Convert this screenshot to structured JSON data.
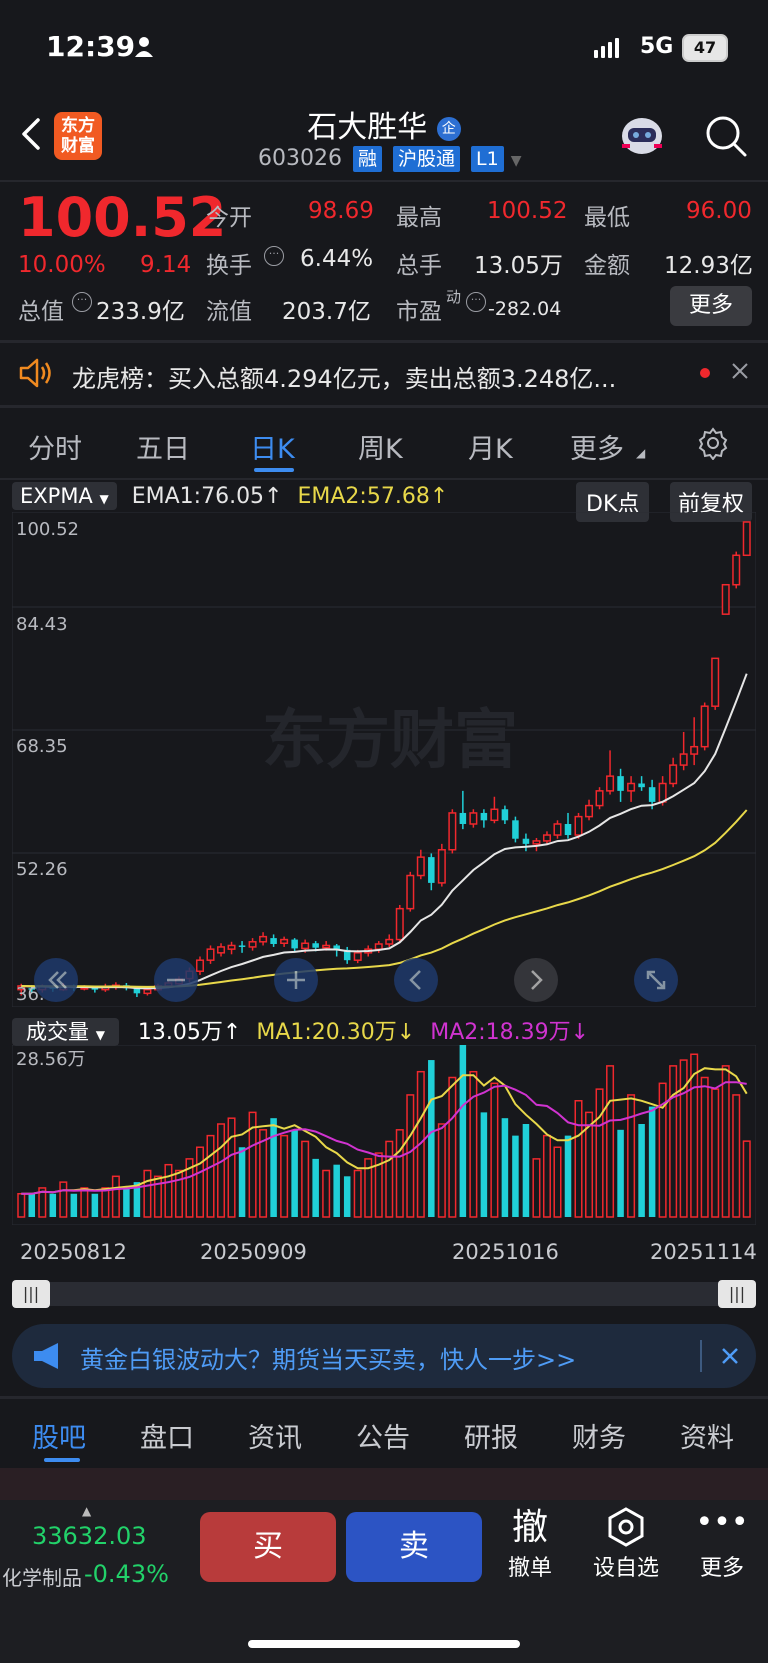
{
  "status_bar": {
    "time": "12:39",
    "network": "5G",
    "battery": "47"
  },
  "header": {
    "title": "石大胜华",
    "code": "603026",
    "tags": [
      "融",
      "沪股通",
      "L1"
    ],
    "logo_text": "东方财富",
    "badge": "企"
  },
  "quote": {
    "price": "100.52",
    "change_pct": "10.00%",
    "change": "9.14",
    "fields": [
      {
        "label": "今开",
        "value": "98.69",
        "color": "red"
      },
      {
        "label": "最高",
        "value": "100.52",
        "color": "red"
      },
      {
        "label": "最低",
        "value": "96.00",
        "color": "red"
      },
      {
        "label": "换手",
        "value": "6.44%",
        "color": "white"
      },
      {
        "label": "总手",
        "value": "13.05万",
        "color": "white"
      },
      {
        "label": "金额",
        "value": "12.93亿",
        "color": "white"
      },
      {
        "label": "总值",
        "value": "233.9亿",
        "color": "white"
      },
      {
        "label": "流值",
        "value": "203.7亿",
        "color": "white"
      },
      {
        "label": "市盈",
        "value": "-282.04",
        "color": "white"
      }
    ],
    "pe_superscript": "动",
    "more_label": "更多"
  },
  "notice": {
    "text": "龙虎榜：买入总额4.294亿元，卖出总额3.248亿..."
  },
  "chart_tabs": [
    "分时",
    "五日",
    "日K",
    "周K",
    "月K",
    "更多"
  ],
  "active_tab": "日K",
  "indicator": {
    "name": "EXPMA",
    "ema1": "EMA1:76.05",
    "ema2": "EMA2:57.68",
    "dk_label": "DK点",
    "adjust_label": "前复权",
    "y_labels": [
      "100.52",
      "84.43",
      "68.35",
      "52.26",
      "36."
    ],
    "watermark": "东方财富"
  },
  "volume": {
    "name": "成交量",
    "value": "13.05万",
    "ma1": "MA1:20.30万",
    "ma2": "MA2:18.39万",
    "max_label": "28.56万",
    "dates": [
      "20250812",
      "20250909",
      "20251016",
      "20251114"
    ]
  },
  "ad_banner": {
    "text": "黄金白银波动大？期货当天买卖，快人一步>>"
  },
  "bottom_tabs": [
    "股吧",
    "盘口",
    "资讯",
    "公告",
    "研报",
    "财务",
    "资料"
  ],
  "footer": {
    "index_value": "33632.03",
    "sector": "化学制品",
    "sector_change": "-0.43%",
    "buy": "买",
    "sell": "卖",
    "cancel_icon_text": "撤",
    "cancel": "撤单",
    "watch": "设自选",
    "more": "更多"
  },
  "colors": {
    "up": "#f0282d",
    "down": "#20d0d8",
    "ema1": "#e6e6e6",
    "ema2": "#e8d84a",
    "ma2": "#d033d0",
    "accent": "#3d8cf0"
  },
  "chart_data": {
    "type": "candlestick",
    "candles": [
      [
        37,
        37.5,
        36.2,
        37.8
      ],
      [
        37.2,
        37,
        36.5,
        37.6
      ],
      [
        37,
        37.4,
        36.6,
        37.7
      ],
      [
        37.3,
        37.1,
        36.7,
        37.6
      ],
      [
        37,
        37.5,
        36.8,
        37.9
      ],
      [
        37.4,
        37.2,
        36.8,
        37.7
      ],
      [
        37.1,
        37.3,
        36.9,
        37.6
      ],
      [
        37.3,
        37,
        36.6,
        37.5
      ],
      [
        37,
        37.4,
        36.7,
        37.8
      ],
      [
        37.4,
        37.6,
        37,
        38
      ],
      [
        37.6,
        37.2,
        36.9,
        37.9
      ],
      [
        37.2,
        36.5,
        36,
        37.4
      ],
      [
        36.5,
        37,
        36.2,
        37.3
      ],
      [
        37,
        37.5,
        36.8,
        37.8
      ],
      [
        37.5,
        37.9,
        37.2,
        38.2
      ],
      [
        37.8,
        38.4,
        37.4,
        38.8
      ],
      [
        38.5,
        39.5,
        38,
        40
      ],
      [
        39.5,
        41,
        39,
        41.5
      ],
      [
        41,
        42.5,
        40.5,
        43
      ],
      [
        42,
        42.8,
        41.5,
        43.3
      ],
      [
        42.5,
        43,
        41.8,
        43.5
      ],
      [
        43,
        42.8,
        42,
        43.6
      ],
      [
        42.8,
        43.5,
        42.3,
        44
      ],
      [
        43.5,
        44.2,
        43,
        44.8
      ],
      [
        44,
        43.2,
        42.8,
        44.5
      ],
      [
        43.3,
        43.8,
        42.8,
        44.2
      ],
      [
        43.8,
        42.6,
        42.2,
        44
      ],
      [
        42.6,
        43.3,
        42,
        43.8
      ],
      [
        43.3,
        42.7,
        42.2,
        43.6
      ],
      [
        42.7,
        43,
        42.3,
        43.6
      ],
      [
        43,
        42.4,
        41.5,
        43.2
      ],
      [
        42.4,
        41,
        40.5,
        42.8
      ],
      [
        41,
        42,
        40.6,
        42.4
      ],
      [
        42,
        42.5,
        41.5,
        43
      ],
      [
        42.5,
        43.2,
        42,
        43.6
      ],
      [
        43.2,
        43.8,
        42.8,
        44.5
      ],
      [
        43.8,
        48,
        43.5,
        48.5
      ],
      [
        48,
        52.5,
        47.6,
        53
      ],
      [
        52.5,
        55,
        52,
        56
      ],
      [
        55,
        51.5,
        50.5,
        55.5
      ],
      [
        51.5,
        56,
        51,
        56.8
      ],
      [
        56,
        61,
        55.5,
        61.5
      ],
      [
        61,
        59.5,
        58.8,
        64
      ],
      [
        59.5,
        61,
        59,
        61.5
      ],
      [
        61,
        60,
        59,
        61.5
      ],
      [
        60,
        61.5,
        59.6,
        63.2
      ],
      [
        61.5,
        60,
        59.5,
        62
      ],
      [
        60,
        57.5,
        57,
        60.5
      ],
      [
        57.5,
        56.8,
        55.8,
        58.2
      ],
      [
        56.8,
        57.2,
        55.8,
        57.6
      ],
      [
        57.2,
        58,
        56.8,
        58.5
      ],
      [
        58,
        59.5,
        57.5,
        60
      ],
      [
        59.5,
        58,
        57.5,
        61
      ],
      [
        58,
        60.5,
        57.5,
        61
      ],
      [
        60.5,
        62,
        60,
        62.8
      ],
      [
        62,
        64,
        61.5,
        64.5
      ],
      [
        64,
        66,
        63.5,
        69.5
      ],
      [
        66,
        64,
        62.5,
        67
      ],
      [
        64,
        65,
        62.5,
        66
      ],
      [
        65,
        64.5,
        64,
        66
      ],
      [
        64.5,
        62.5,
        61.5,
        65.5
      ],
      [
        62.5,
        65,
        62,
        66
      ],
      [
        65,
        67.5,
        64.5,
        68.5
      ],
      [
        67.5,
        69,
        66.8,
        72
      ],
      [
        69,
        70,
        67.5,
        74
      ],
      [
        70,
        75.5,
        69.5,
        76
      ],
      [
        75.5,
        82,
        75,
        82
      ],
      [
        88,
        92,
        88,
        92
      ],
      [
        92,
        96,
        91.5,
        96.5
      ],
      [
        96,
        100.52,
        96,
        100.52
      ]
    ],
    "volume": [
      4,
      4,
      5,
      4,
      6,
      4,
      5,
      4,
      5,
      7,
      5,
      6,
      8,
      7,
      9,
      8,
      10,
      12,
      14,
      16,
      17,
      12,
      18,
      15,
      17,
      14,
      15,
      13,
      10,
      8,
      9,
      7,
      8,
      10,
      11,
      13,
      15,
      21,
      25,
      27,
      16,
      24,
      30,
      25,
      18,
      23,
      17,
      14,
      16,
      10,
      14,
      12,
      14,
      20,
      18,
      22,
      26,
      15,
      21,
      16,
      19,
      23,
      26,
      27,
      28,
      24,
      22,
      26,
      21,
      13.05
    ],
    "ylim": [
      36,
      100.52
    ]
  }
}
